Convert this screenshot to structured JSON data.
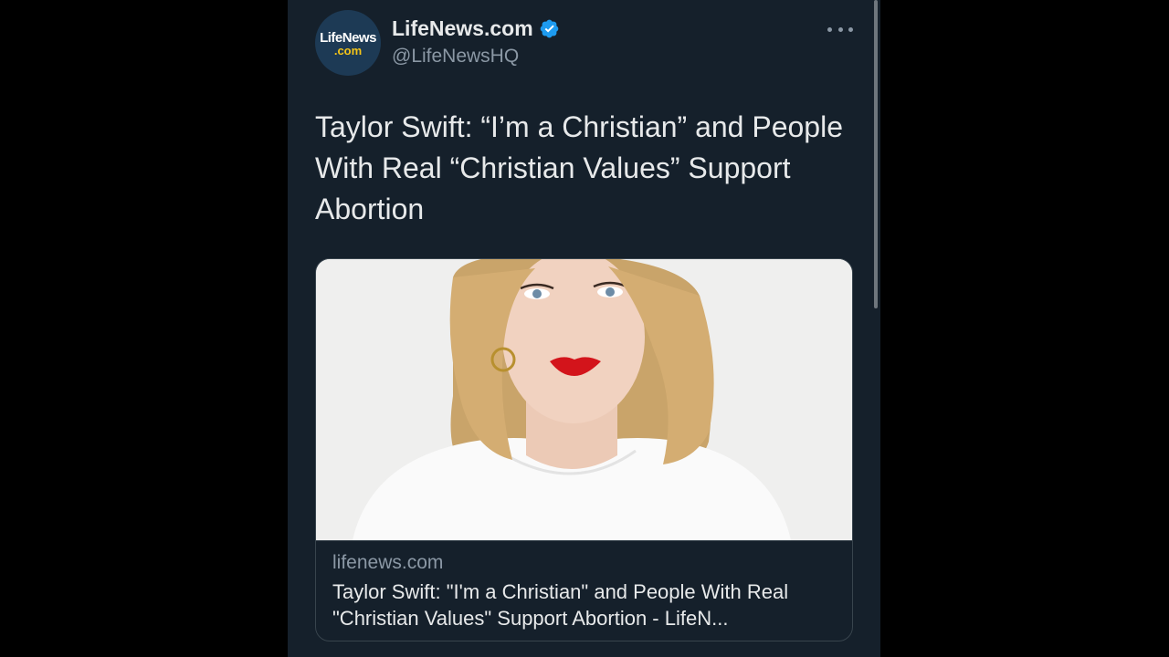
{
  "account": {
    "avatar_text_top": "LifeNews",
    "avatar_text_bottom": ".com",
    "display_name": "LifeNews.com",
    "handle": "@LifeNewsHQ",
    "verified": true
  },
  "icons": {
    "verified": "verified-badge-icon",
    "more": "more-options-icon"
  },
  "tweet": {
    "text": "Taylor Swift: “I’m a Christian” and People With Real “Christian Values” Support Abortion"
  },
  "link_card": {
    "domain": "lifenews.com",
    "title": "Taylor Swift: \"I'm a Christian\" and People With Real \"Christian Values\" Support Abortion - LifeN..."
  },
  "colors": {
    "background": "#15202b",
    "primary_text": "#e7e9ea",
    "secondary_text": "#8b98a5",
    "verified_blue": "#1d9bf0",
    "border": "#38444d"
  }
}
